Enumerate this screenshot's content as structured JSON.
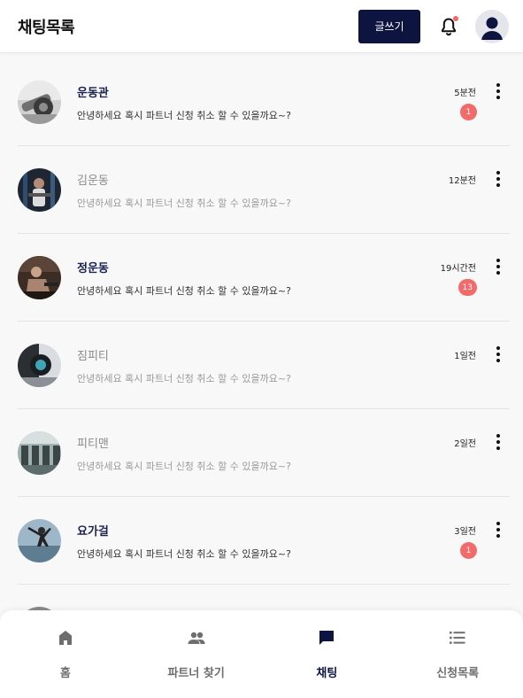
{
  "header": {
    "title": "채팅목록",
    "write_label": "글쓰기"
  },
  "colors": {
    "brand": "#0d1440",
    "badge": "#f26b6b",
    "bell_dot": "#f0656e"
  },
  "chats": [
    {
      "name": "운동관",
      "message": "안녕하세요 혹시 파트너 신청 취소 할 수 있을까요~?",
      "time": "5분전",
      "unread_count": "1",
      "read": false
    },
    {
      "name": "김운동",
      "message": "안녕하세요 혹시 파트너 신청 취소 할 수 있을까요~?",
      "time": "12분전",
      "unread_count": "",
      "read": true
    },
    {
      "name": "정운동",
      "message": "안녕하세요 혹시 파트너 신청 취소 할 수 있을까요~?",
      "time": "19시간전",
      "unread_count": "13",
      "read": false
    },
    {
      "name": "짐피티",
      "message": "안녕하세요 혹시 파트너 신청 취소 할 수 있을까요~?",
      "time": "1일전",
      "unread_count": "",
      "read": true
    },
    {
      "name": "피티맨",
      "message": "안녕하세요 혹시 파트너 신청 취소 할 수 있을까요~?",
      "time": "2일전",
      "unread_count": "",
      "read": true
    },
    {
      "name": "요가걸",
      "message": "안녕하세요 혹시 파트너 신청 취소 할 수 있을까요~?",
      "time": "3일전",
      "unread_count": "1",
      "read": false
    }
  ],
  "nav": [
    {
      "label": "홈",
      "icon": "home-icon",
      "active": false
    },
    {
      "label": "파트너 찾기",
      "icon": "people-icon",
      "active": false
    },
    {
      "label": "채팅",
      "icon": "chat-icon",
      "active": true
    },
    {
      "label": "신청목록",
      "icon": "list-icon",
      "active": false
    }
  ]
}
